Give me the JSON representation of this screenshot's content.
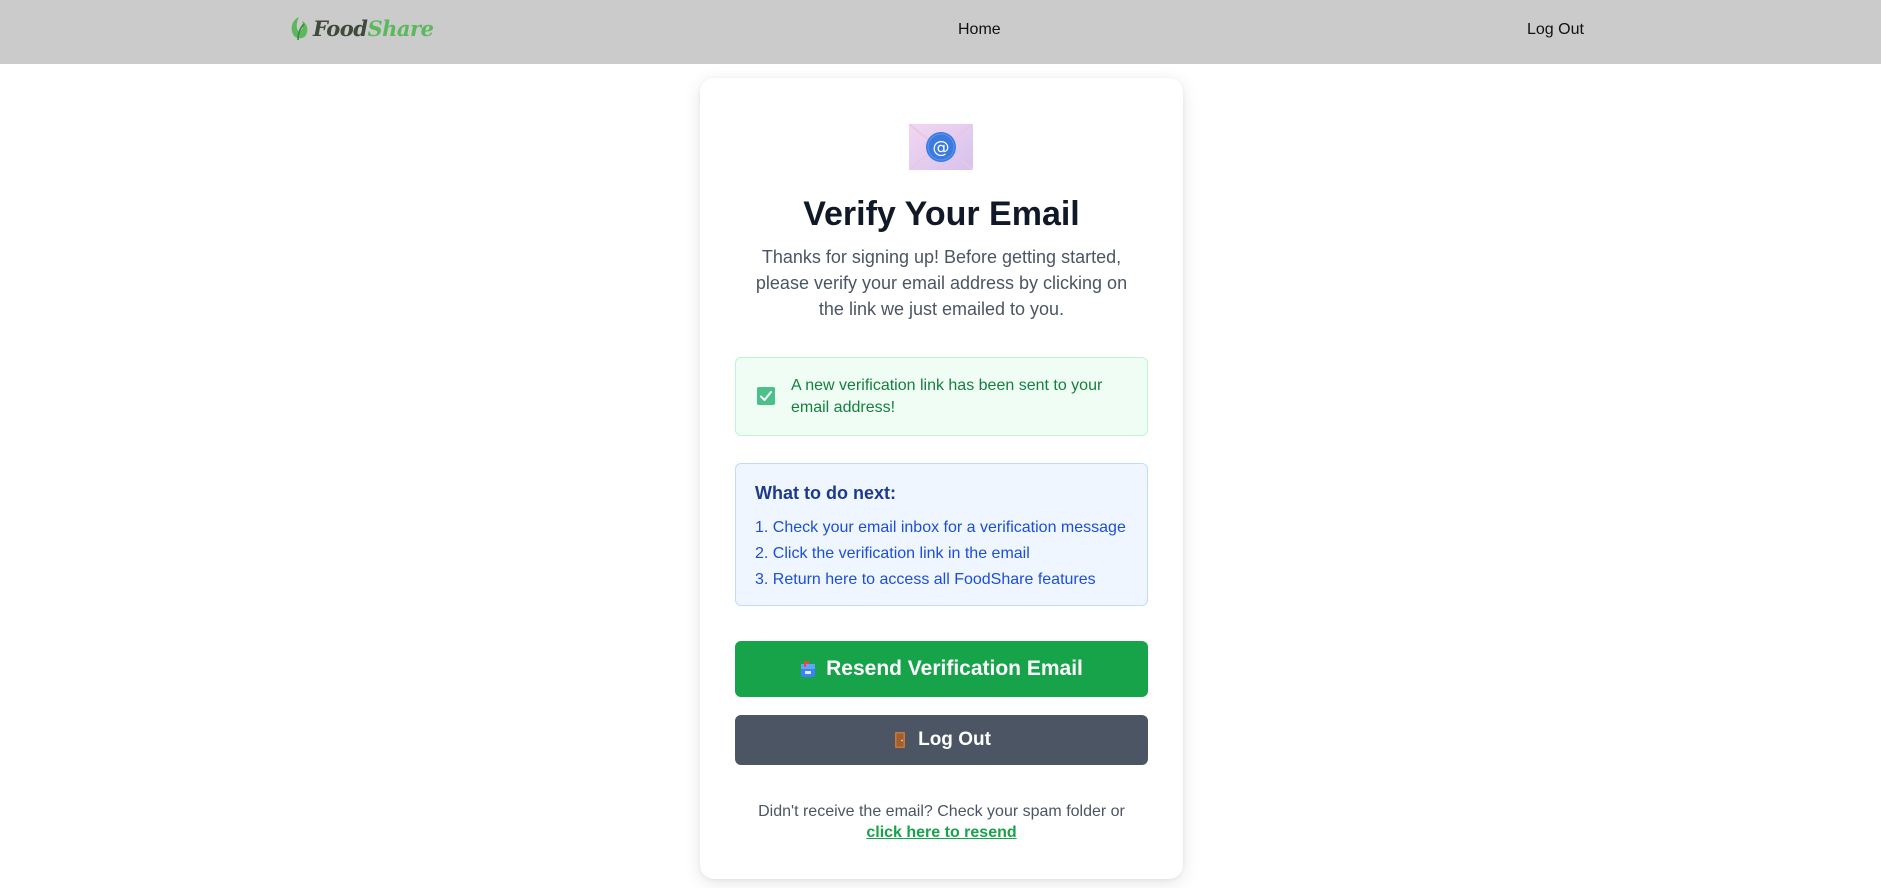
{
  "nav": {
    "logo_text_1": "Food",
    "logo_text_2": "Share",
    "home_label": "Home",
    "logout_label": "Log Out"
  },
  "card": {
    "icon": "envelope-at-icon",
    "title": "Verify Your Email",
    "subtitle": "Thanks for signing up! Before getting started, please verify your email address by clicking on the link we just emailed to you.",
    "alert": {
      "icon": "check-square-icon",
      "text": "A new verification link has been sent to your email address!"
    },
    "next_steps": {
      "title": "What to do next:",
      "items": [
        "1. Check your email inbox for a verification message",
        "2. Click the verification link in the email",
        "3. Return here to access all FoodShare features"
      ]
    },
    "resend_button": {
      "icon": "mailbox-icon",
      "label": "Resend Verification Email"
    },
    "logout_button": {
      "icon": "door-icon",
      "label": "Log Out"
    },
    "footer": {
      "text": "Didn't receive the email? Check your spam folder or",
      "link": "click here to resend"
    }
  },
  "colors": {
    "nav_bg": "#cbcbcb",
    "primary_green": "#16a34a",
    "logout_gray": "#4b5563",
    "alert_bg": "#f0fdf4",
    "info_bg": "#eff6ff"
  }
}
